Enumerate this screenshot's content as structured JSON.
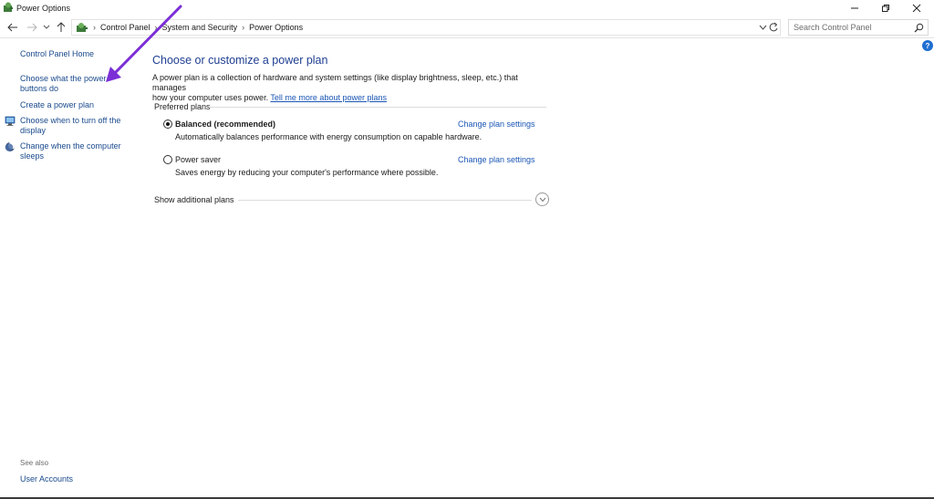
{
  "window": {
    "title": "Power Options"
  },
  "address": {
    "crumbs": [
      "Control Panel",
      "System and Security",
      "Power Options"
    ]
  },
  "search": {
    "placeholder": "Search Control Panel"
  },
  "sidebar": {
    "home": "Control Panel Home",
    "items": [
      {
        "label_line1": "Choose what the power",
        "label_line2": "buttons do"
      },
      {
        "label_line1": "Create a power plan",
        "label_line2": ""
      },
      {
        "label_line1": "Choose when to turn off the",
        "label_line2": "display",
        "icon": "monitor-icon"
      },
      {
        "label_line1": "Change when the computer",
        "label_line2": "sleeps",
        "icon": "moon-icon"
      }
    ],
    "see_also": "See also",
    "user_accounts": "User Accounts"
  },
  "main": {
    "title": "Choose or customize a power plan",
    "desc_line1": "A power plan is a collection of hardware and system settings (like display brightness, sleep, etc.) that manages",
    "desc_line2": "how your computer uses power.",
    "desc_link": "Tell me more about power plans",
    "preferred_label": "Preferred plans",
    "plans": [
      {
        "name": "Balanced (recommended)",
        "desc": "Automatically balances performance with energy consumption on capable hardware.",
        "link": "Change plan settings",
        "selected": true
      },
      {
        "name": "Power saver",
        "desc": "Saves energy by reducing your computer's performance where possible.",
        "link": "Change plan settings",
        "selected": false
      }
    ],
    "show_more": "Show additional plans"
  },
  "colors": {
    "link": "#1a56b4",
    "title": "#1e3e91",
    "annotation_arrow": "#7b2fd6"
  }
}
